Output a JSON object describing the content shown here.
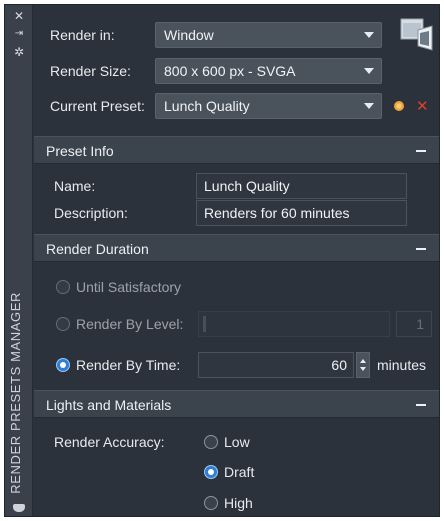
{
  "panel": {
    "vertical_title": "RENDER PRESETS MANAGER",
    "strip_icons": [
      "close-icon",
      "auto-hide-icon",
      "properties-icon"
    ]
  },
  "top": {
    "render_in": {
      "label": "Render in:",
      "value": "Window"
    },
    "render_size": {
      "label": "Render Size:",
      "value": "800 x 600 px - SVGA"
    },
    "current_preset": {
      "label": "Current Preset:",
      "value": "Lunch Quality"
    }
  },
  "preset_info": {
    "title": "Preset Info",
    "name_label": "Name:",
    "name_value": "Lunch Quality",
    "description_label": "Description:",
    "description_value": "Renders for 60 minutes"
  },
  "render_duration": {
    "title": "Render Duration",
    "until_satisfactory": "Until Satisfactory",
    "render_by_level": "Render By Level:",
    "level_value": "1",
    "render_by_time": "Render By Time:",
    "time_value": "60",
    "time_unit": "minutes",
    "selected": "render_by_time"
  },
  "lights_materials": {
    "title": "Lights and Materials",
    "accuracy_label": "Render Accuracy:",
    "options": [
      "Low",
      "Draft",
      "High"
    ],
    "selected": "Draft"
  },
  "colors": {
    "background": "#2b323b",
    "header": "#3b434d",
    "accent_radio": "#2f7fd4",
    "star_icon": "#f2a33a",
    "delete_icon": "#d9412f"
  }
}
